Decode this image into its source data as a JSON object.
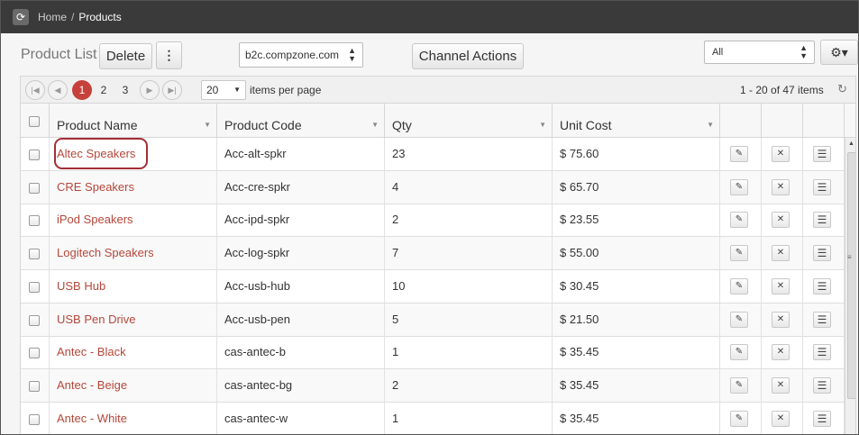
{
  "breadcrumb": {
    "home": "Home",
    "separator": "/",
    "current": "Products"
  },
  "toolbar": {
    "title": "Product List",
    "delete_label": "Delete",
    "more_label": "⋮",
    "site_value": "b2c.compzone.com",
    "channel_actions_label": "Channel Actions",
    "filter_value": "All",
    "gear_label": "⚙▾"
  },
  "pager": {
    "pages": [
      "1",
      "2",
      "3"
    ],
    "current_page": "1",
    "per_page": "20",
    "per_page_label": "items per page",
    "range": "1 - 20 of 47 items"
  },
  "columns": [
    "Product Name",
    "Product Code",
    "Qty",
    "Unit Cost"
  ],
  "rows": [
    {
      "name": "Altec Speakers",
      "code": "Acc-alt-spkr",
      "qty": "23",
      "cost": "$ 75.60"
    },
    {
      "name": "CRE Speakers",
      "code": "Acc-cre-spkr",
      "qty": "4",
      "cost": "$ 65.70"
    },
    {
      "name": "iPod Speakers",
      "code": "Acc-ipd-spkr",
      "qty": "2",
      "cost": "$ 23.55"
    },
    {
      "name": "Logitech Speakers",
      "code": "Acc-log-spkr",
      "qty": "7",
      "cost": "$ 55.00"
    },
    {
      "name": "USB Hub",
      "code": "Acc-usb-hub",
      "qty": "10",
      "cost": "$ 30.45"
    },
    {
      "name": "USB Pen Drive",
      "code": "Acc-usb-pen",
      "qty": "5",
      "cost": "$ 21.50"
    },
    {
      "name": "Antec - Black",
      "code": "cas-antec-b",
      "qty": "1",
      "cost": "$ 35.45"
    },
    {
      "name": "Antec - Beige",
      "code": "cas-antec-bg",
      "qty": "2",
      "cost": "$ 35.45"
    },
    {
      "name": "Antec - White",
      "code": "cas-antec-w",
      "qty": "1",
      "cost": "$ 35.45"
    }
  ],
  "colors": {
    "accent": "#c5413a",
    "link": "#b5473a",
    "topbar": "#3a3a3a",
    "highlight": "#a32e36"
  }
}
